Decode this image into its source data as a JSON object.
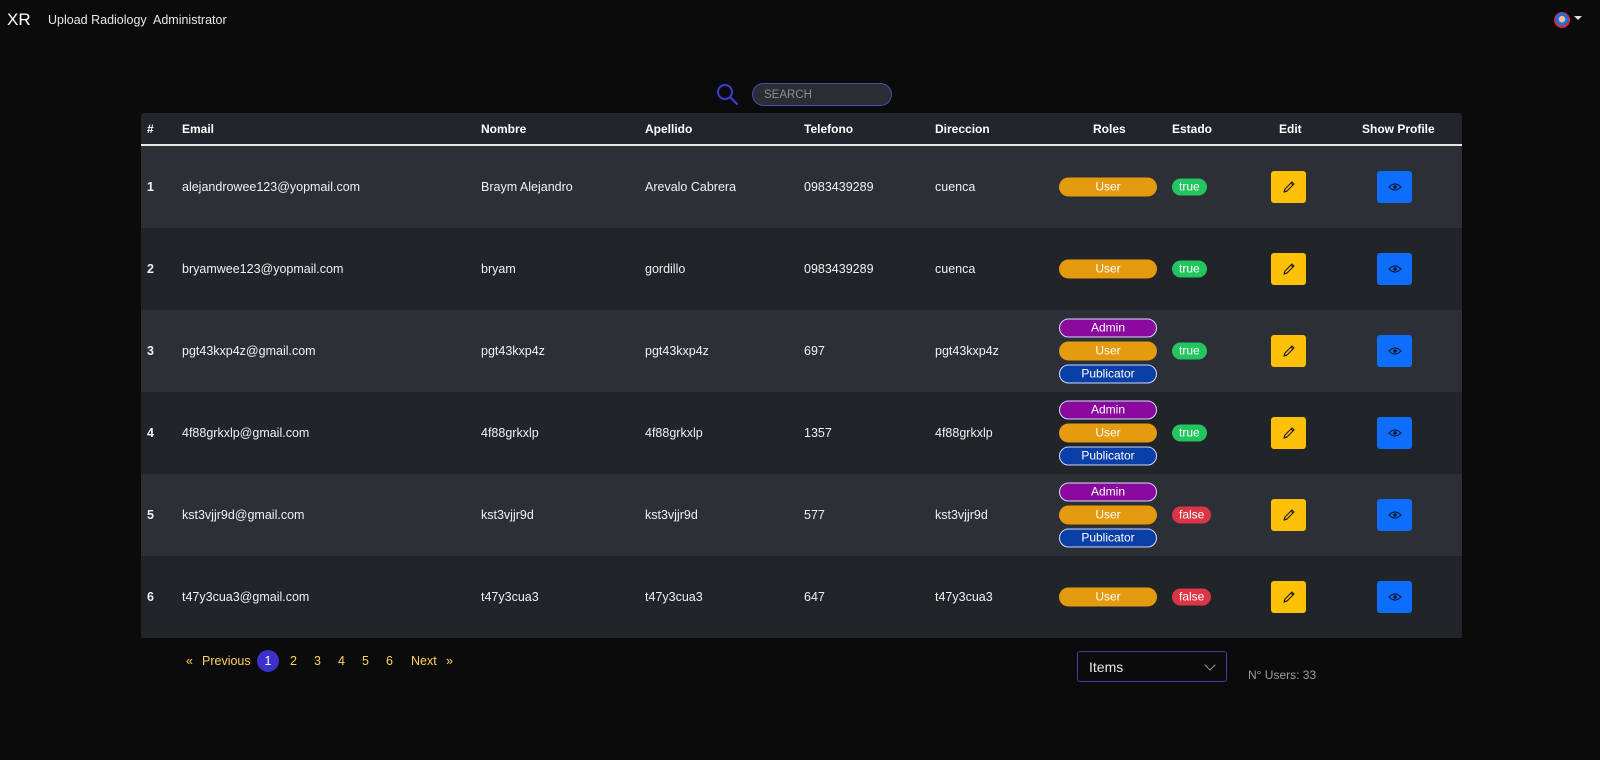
{
  "nav": {
    "brand": "XR",
    "links": [
      "Upload Radiology",
      "Administrator"
    ]
  },
  "search": {
    "placeholder": "SEARCH"
  },
  "table": {
    "headers": {
      "num": "#",
      "email": "Email",
      "nombre": "Nombre",
      "apellido": "Apellido",
      "telefono": "Telefono",
      "direccion": "Direccion",
      "roles": "Roles",
      "estado": "Estado",
      "edit": "Edit",
      "show": "Show Profile"
    },
    "rows": [
      {
        "num": "1",
        "email": "alejandrowee123@yopmail.com",
        "nombre": "Braym Alejandro",
        "apellido": "Arevalo Cabrera",
        "telefono": "0983439289",
        "direccion": "cuenca",
        "roles": [
          "User"
        ],
        "estado": "true"
      },
      {
        "num": "2",
        "email": "bryamwee123@yopmail.com",
        "nombre": "bryam",
        "apellido": "gordillo",
        "telefono": "0983439289",
        "direccion": "cuenca",
        "roles": [
          "User"
        ],
        "estado": "true"
      },
      {
        "num": "3",
        "email": "pgt43kxp4z@gmail.com",
        "nombre": "pgt43kxp4z",
        "apellido": "pgt43kxp4z",
        "telefono": "697",
        "direccion": "pgt43kxp4z",
        "roles": [
          "Admin",
          "User",
          "Publicator"
        ],
        "estado": "true"
      },
      {
        "num": "4",
        "email": "4f88grkxlp@gmail.com",
        "nombre": "4f88grkxlp",
        "apellido": "4f88grkxlp",
        "telefono": "1357",
        "direccion": "4f88grkxlp",
        "roles": [
          "Admin",
          "User",
          "Publicator"
        ],
        "estado": "true"
      },
      {
        "num": "5",
        "email": "kst3vjjr9d@gmail.com",
        "nombre": "kst3vjjr9d",
        "apellido": "kst3vjjr9d",
        "telefono": "577",
        "direccion": "kst3vjjr9d",
        "roles": [
          "Admin",
          "User",
          "Publicator"
        ],
        "estado": "false"
      },
      {
        "num": "6",
        "email": "t47y3cua3@gmail.com",
        "nombre": "t47y3cua3",
        "apellido": "t47y3cua3",
        "telefono": "647",
        "direccion": "t47y3cua3",
        "roles": [
          "User"
        ],
        "estado": "false"
      }
    ]
  },
  "pagination": {
    "prev": "«",
    "prev_label": "Previous",
    "pages": [
      "1",
      "2",
      "3",
      "4",
      "5",
      "6"
    ],
    "current": "1",
    "next_label": "Next",
    "next": "»"
  },
  "items_select": {
    "label": "Items"
  },
  "users_count": "N° Users: 33",
  "colors": {
    "user_badge": "#e49b0f",
    "admin_badge": "#8b0a9e",
    "publicator_badge": "#0b3fa8",
    "true_badge": "#22c55e",
    "false_badge": "#dc3545",
    "edit_button": "#ffc107",
    "show_button": "#0d6efd",
    "active_page": "#3b32c9"
  }
}
